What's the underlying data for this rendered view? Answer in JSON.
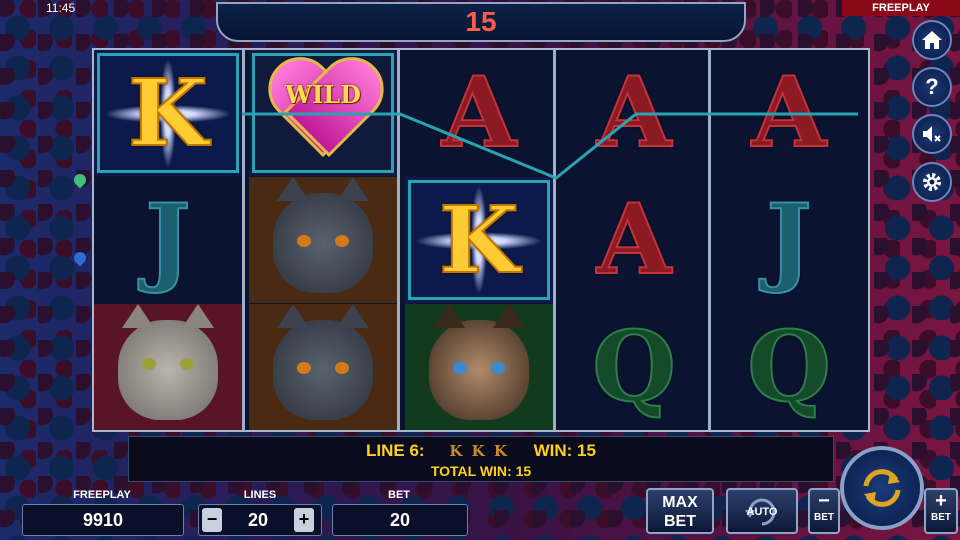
{
  "status": {
    "clock": "11:45",
    "mode_tag": "FREEPLAY"
  },
  "top_display": {
    "value": "15"
  },
  "reels": [
    [
      "K",
      "J",
      "cat-tabby"
    ],
    [
      "WILD",
      "cat-grey",
      "cat-grey"
    ],
    [
      "A",
      "K",
      "cat-siamese"
    ],
    [
      "A",
      "A",
      "Q"
    ],
    [
      "A",
      "J",
      "Q"
    ]
  ],
  "wild_label": "WILD",
  "message": {
    "line_label": "LINE 6:",
    "line_symbols": "K K K",
    "win_label": "WIN: 15",
    "total_win": "TOTAL WIN: 15"
  },
  "bottom": {
    "freeplay_label": "FREEPLAY",
    "freeplay_value": "9910",
    "lines_label": "LINES",
    "lines_value": "20",
    "lines_minus": "−",
    "lines_plus": "+",
    "bet_label": "BET",
    "bet_value": "20",
    "maxbet_line1": "MAX",
    "maxbet_line2": "BET",
    "auto_label": "AUTO",
    "bet_minus_label": "BET",
    "bet_plus_label": "BET",
    "bet_minus_sign": "−",
    "bet_plus_sign": "+"
  },
  "menu": [
    "home-icon",
    "help-icon",
    "sound-off-icon",
    "settings-icon"
  ],
  "colors": {
    "win_gold": "#ffd21a",
    "win_red": "#ff5b4c",
    "payline": "#29a3b2"
  }
}
